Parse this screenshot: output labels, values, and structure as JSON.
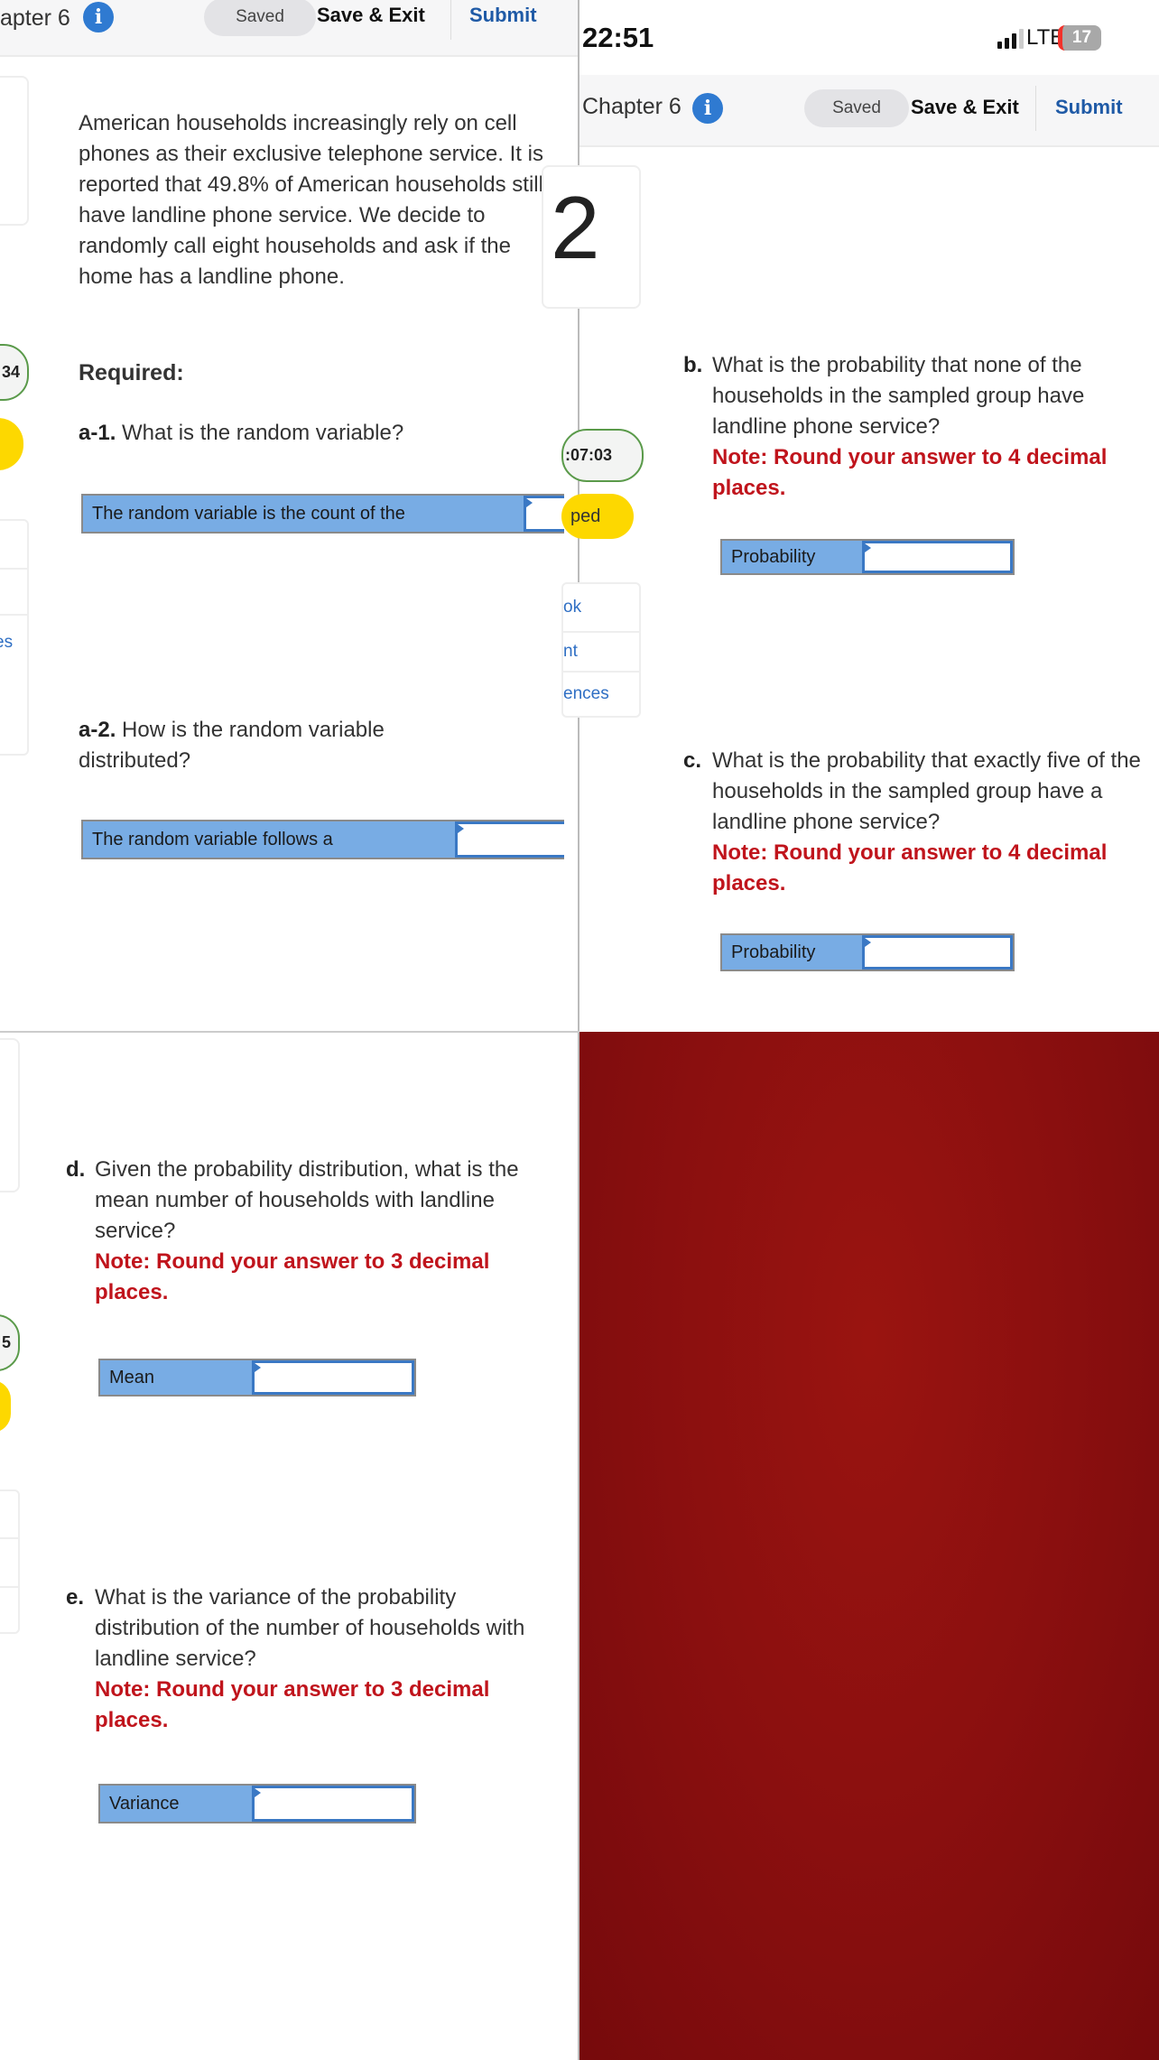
{
  "left_header": {
    "chapter": "apter 6",
    "saved": "Saved",
    "save_exit": "Save & Exit",
    "submit": "Submit"
  },
  "status_bar": {
    "time": "22:51",
    "network": "LTE",
    "battery": "17"
  },
  "right_header": {
    "chapter": "Chapter 6",
    "saved": "Saved",
    "save_exit": "Save & Exit",
    "submit": "Submit"
  },
  "question_number": "2",
  "sidebar": {
    "score_left": "34",
    "timer": ":07:03",
    "skipped": "ped",
    "links_right": [
      "ok",
      "nt",
      "ences"
    ],
    "links_left": [
      "es"
    ],
    "score_bottom": "5"
  },
  "intro": "American households increasingly rely on cell phones as their exclusive telephone service. It is reported that 49.8% of American households still have landline phone service. We decide to randomly call eight households and ask if the home has a landline phone.",
  "required": "Required:",
  "a1": {
    "label": "a-1.",
    "text": " What is the random variable?",
    "answer_label": "The random variable is the count of the",
    "answer_value": ""
  },
  "a2": {
    "label": "a-2.",
    "text": " How is the random variable distributed?",
    "answer_label": "The random variable follows a",
    "answer_value": ""
  },
  "b": {
    "label": "b.",
    "text": "What is the probability that none of the households in the sampled group have landline phone service?",
    "note": "Note: Round your answer to 4 decimal places.",
    "answer_label": "Probability",
    "answer_value": ""
  },
  "c": {
    "label": "c.",
    "text": "What is the probability that exactly five of the households in the sampled group have a landline phone service?",
    "note": "Note: Round your answer to 4 decimal places.",
    "answer_label": "Probability",
    "answer_value": ""
  },
  "d": {
    "label": "d.",
    "text": "Given the probability distribution, what is the mean number of households with landline service?",
    "note": "Note: Round your answer to 3 decimal places.",
    "answer_label": "Mean",
    "answer_value": ""
  },
  "e": {
    "label": "e.",
    "text": "What is the variance of the probability distribution of the number of households with landline service?",
    "note": "Note: Round your answer to 3 decimal places.",
    "answer_label": "Variance",
    "answer_value": ""
  },
  "colors": {
    "accent": "#2f7ad1",
    "note": "#c0141c",
    "answer_label_bg": "#78ace4",
    "background_panel": "#8a0f0f"
  }
}
